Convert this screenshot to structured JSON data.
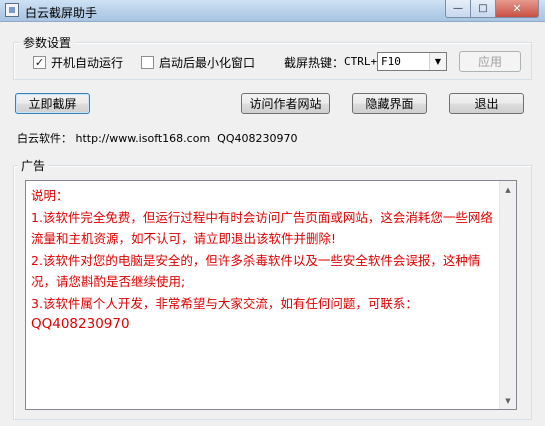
{
  "window": {
    "title": "白云截屏助手",
    "minimize_glyph": "—",
    "maximize_glyph": "□",
    "close_glyph": "✕"
  },
  "settings": {
    "group_label": "参数设置",
    "autostart_label": "开机自动运行",
    "autostart_checked": true,
    "minimize_label": "启动后最小化窗口",
    "minimize_checked": false,
    "hotkey_label": "截屏热键：",
    "hotkey_prefix": "CTRL+",
    "hotkey_value": "F10",
    "apply_label": "应用"
  },
  "actions": {
    "capture_label": "立即截屏",
    "visit_label": "访问作者网站",
    "hide_label": "隐藏界面",
    "exit_label": "退出"
  },
  "info": {
    "text": "白云软件： http://www.isoft168.com  QQ408230970"
  },
  "ad": {
    "group_label": "广告",
    "lines": [
      "说明：",
      "1.该软件完全免费，但运行过程中有时会访问广告页面或网站，这会消耗您一些网络流量和主机资源，如不认可，请立即退出该软件并删除!",
      "2.该软件对您的电脑是安全的，但许多杀毒软件以及一些安全软件会误报，这种情况，请您斟酌是否继续使用;",
      "3.该软件属个人开发，非常希望与大家交流，如有任何问题，可联系：",
      "QQ408230970"
    ],
    "text_color": "#e00000"
  }
}
